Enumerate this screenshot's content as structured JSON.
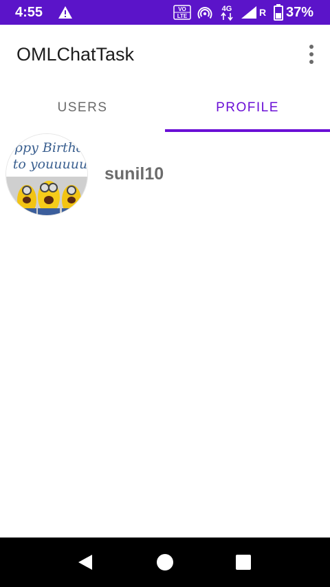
{
  "status_bar": {
    "time": "4:55",
    "volte_top": "VO",
    "volte_bottom": "LTE",
    "network_type": "4G",
    "roaming": "R",
    "battery": "37%",
    "color": "#5b14c9"
  },
  "app_bar": {
    "title": "OMLChatTask",
    "overflow_icon": "more-vert-icon"
  },
  "tabs": [
    {
      "label": "USERS",
      "selected": false
    },
    {
      "label": "PROFILE",
      "selected": true
    }
  ],
  "profile": {
    "username": "sunil10",
    "avatar_caption_line1": "Happy Birthday",
    "avatar_caption_line2": "to youuuuu"
  },
  "accent_color": "#6a0fd6",
  "nav_bar": {
    "back_icon": "back-triangle-icon",
    "home_icon": "home-circle-icon",
    "recents_icon": "recents-square-icon"
  }
}
